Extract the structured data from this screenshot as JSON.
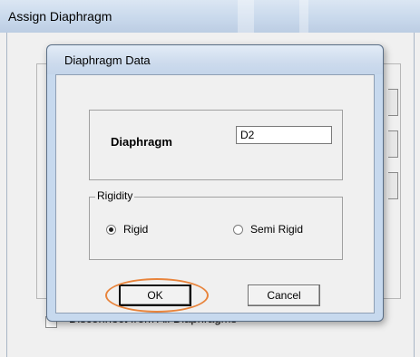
{
  "background_window": {
    "title": "Assign Diaphragm",
    "checkbox_label": "Disconnect from All Diaphragms"
  },
  "dialog": {
    "title": "Diaphragm Data",
    "diaphragm_label": "Diaphragm",
    "diaphragm_value": "D2",
    "rigidity": {
      "legend": "Rigidity",
      "options": [
        {
          "label": "Rigid",
          "selected": true
        },
        {
          "label": "Semi Rigid",
          "selected": false
        }
      ]
    },
    "ok_label": "OK",
    "cancel_label": "Cancel"
  },
  "colors": {
    "titlebar": "#c9d9ec",
    "dialog_frame": "#c7d9ee",
    "client_bg": "#f0f0f0",
    "highlight": "#e8843c"
  }
}
